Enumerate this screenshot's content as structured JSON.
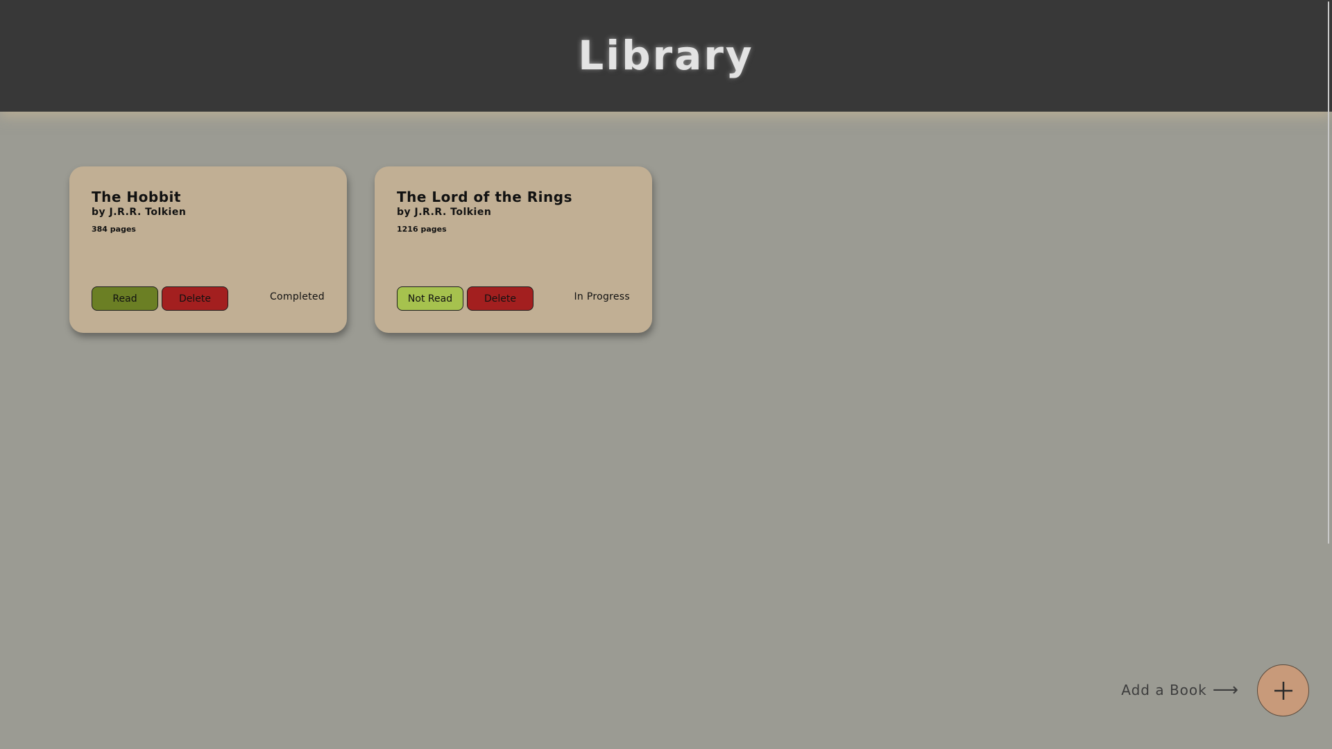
{
  "header": {
    "title": "Library"
  },
  "books": [
    {
      "title": "The Hobbit",
      "author": "by J.R.R. Tolkien",
      "pages": "384 pages",
      "read_label": "Read",
      "delete_label": "Delete",
      "status": "Completed"
    },
    {
      "title": "The Lord of the Rings",
      "author": "by J.R.R. Tolkien",
      "pages": "1216 pages",
      "read_label": "Not Read",
      "delete_label": "Delete",
      "status": "In Progress"
    }
  ],
  "add_book": {
    "label": "Add a Book",
    "arrow_icon": "arrow-right-icon",
    "button_icon": "plus-icon"
  },
  "colors": {
    "header_bg": "#383838",
    "page_bg": "#9b9b93",
    "card_bg": "#c1af94",
    "read_button": "#6b7f24",
    "not_read_button": "#a6c24e",
    "delete_button": "#a31f1f",
    "add_button": "#c89a7a"
  }
}
